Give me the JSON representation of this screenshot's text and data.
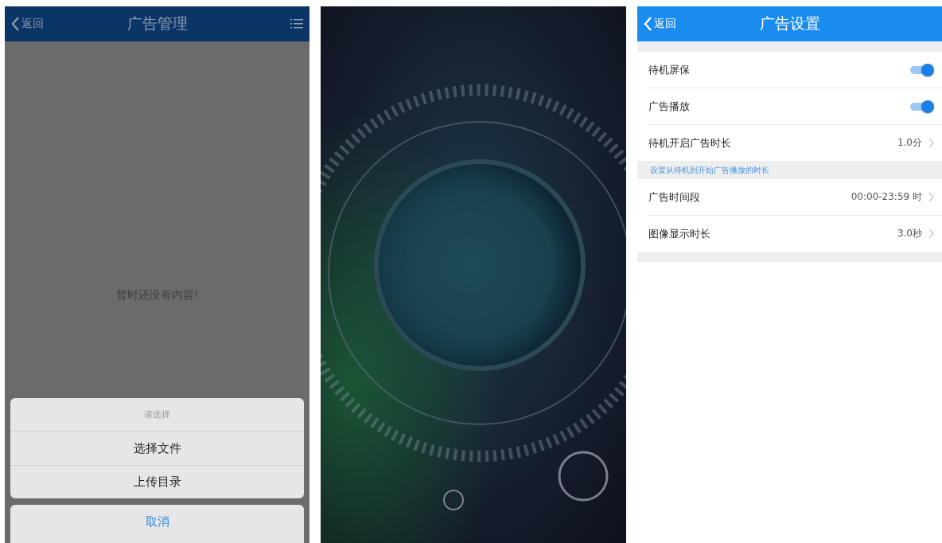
{
  "ad_management": {
    "nav": {
      "back": "返回",
      "title": "广告管理",
      "has_menu": true
    },
    "empty_text": "暂时还没有内容!",
    "action_sheet": {
      "title": "请选择",
      "options": [
        "选择文件",
        "上传目录"
      ],
      "cancel": "取消"
    }
  },
  "ad_settings": {
    "nav": {
      "back": "返回",
      "title": "广告设置",
      "has_menu": false
    },
    "rows": [
      {
        "kind": "toggle",
        "label": "待机屏保",
        "on": true
      },
      {
        "kind": "toggle",
        "label": "广告播放",
        "on": true
      },
      {
        "kind": "value",
        "label": "待机开启广告时长",
        "value": "1.0分"
      },
      {
        "kind": "hint",
        "label": "设置从待机到开始广告播放的时长"
      },
      {
        "kind": "value",
        "label": "广告时间段",
        "value": "00:00-23:59 时"
      },
      {
        "kind": "value",
        "label": "图像显示时长",
        "value": "3.0秒"
      }
    ]
  }
}
